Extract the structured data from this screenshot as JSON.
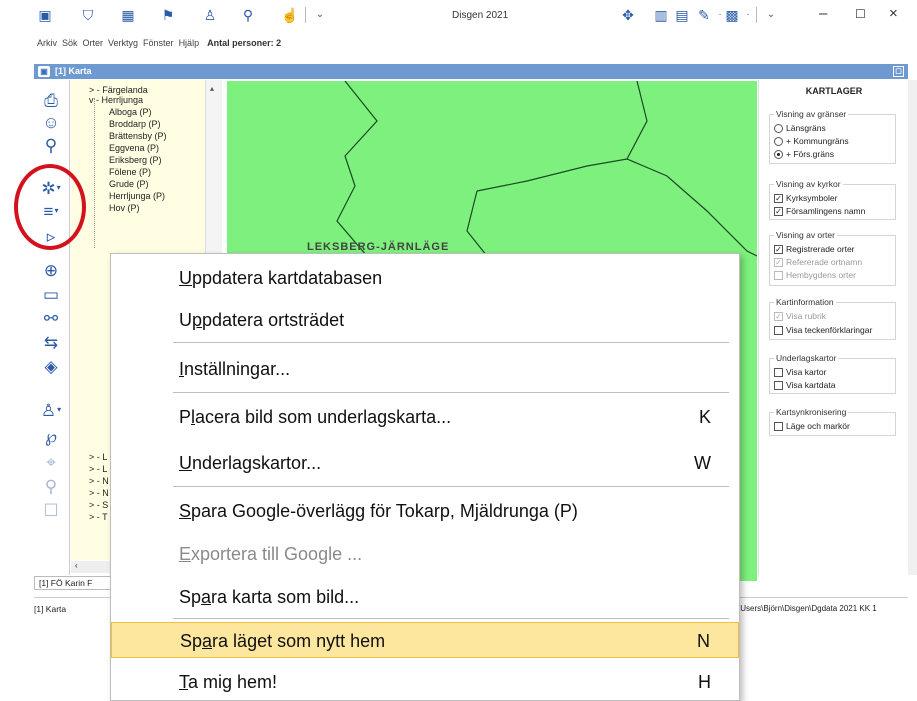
{
  "app": {
    "title": "Disgen 2021",
    "menu": [
      "Arkiv",
      "Sök",
      "Orter",
      "Verktyg",
      "Fönster",
      "Hjälp"
    ],
    "persons_label": "Antal personer: 2"
  },
  "window": {
    "title": "[1] Karta",
    "tab_label": "[1] FÖ Karin F",
    "status_left": "[1] Karta",
    "status_right": "\\Users\\Björn\\Disgen\\Dgdata 2021 KK 1"
  },
  "tree": {
    "items": [
      {
        "label": "Färgelanda",
        "prefix": ">"
      },
      {
        "label": "Herrljunga",
        "prefix": "v"
      },
      {
        "label": "Alboga (P)"
      },
      {
        "label": "Broddarp (P)"
      },
      {
        "label": "Brättensby (P)"
      },
      {
        "label": "Eggvena (P)"
      },
      {
        "label": "Eriksberg (P)"
      },
      {
        "label": "Fölene (P)"
      },
      {
        "label": "Grude (P)"
      },
      {
        "label": "Herrljunga (P)"
      },
      {
        "label": "Hov (P)"
      }
    ],
    "bottom_items": [
      "L",
      "L",
      "N",
      "N",
      "S",
      "T"
    ]
  },
  "layers": {
    "title": "KARTLAGER",
    "groups": [
      {
        "title": "Visning av gränser",
        "type": "radio",
        "options": [
          {
            "label": "Länsgräns",
            "checked": false,
            "disabled": false
          },
          {
            "label": "+ Kommungräns",
            "checked": false,
            "disabled": false
          },
          {
            "label": "+ Förs.gräns",
            "checked": true,
            "disabled": false
          }
        ]
      },
      {
        "title": "Visning av kyrkor",
        "type": "check",
        "options": [
          {
            "label": "Kyrksymboler",
            "checked": true,
            "disabled": false
          },
          {
            "label": "Församlingens namn",
            "checked": true,
            "disabled": false
          }
        ]
      },
      {
        "title": "Visning av orter",
        "type": "check",
        "options": [
          {
            "label": "Registrerade orter",
            "checked": true,
            "disabled": false
          },
          {
            "label": "Refererade ortnamn",
            "checked": true,
            "disabled": true
          },
          {
            "label": "Hembygdens orter",
            "checked": false,
            "disabled": true
          }
        ]
      },
      {
        "title": "Kartinformation",
        "type": "check",
        "options": [
          {
            "label": "Visa rubrik",
            "checked": true,
            "disabled": true
          },
          {
            "label": "Visa teckenförklaringar",
            "checked": false,
            "disabled": false
          }
        ]
      },
      {
        "title": "Underlagskartor",
        "type": "check",
        "options": [
          {
            "label": "Visa kartor",
            "checked": false,
            "disabled": false
          },
          {
            "label": "Visa kartdata",
            "checked": false,
            "disabled": false
          }
        ]
      },
      {
        "title": "Kartsynkronisering",
        "type": "check",
        "options": [
          {
            "label": "Läge och markör",
            "checked": false,
            "disabled": false
          }
        ]
      }
    ]
  },
  "context_menu": {
    "items": [
      {
        "label": "Uppdatera kartdatabasen",
        "mnemonic": "U",
        "key": "",
        "disabled": false,
        "highlight": false
      },
      {
        "label": "Uppdatera ortsträdet",
        "mnemonic": "p",
        "key": "",
        "disabled": false,
        "highlight": false
      },
      {
        "label": "Inställningar...",
        "mnemonic": "I",
        "key": "",
        "disabled": false,
        "highlight": false
      },
      {
        "label": "Placera bild som underlagskarta...",
        "mnemonic": "l",
        "key": "K",
        "disabled": false,
        "highlight": false
      },
      {
        "label": "Underlagskartor...",
        "mnemonic": "U",
        "key": "W",
        "disabled": false,
        "highlight": false
      },
      {
        "label": "Spara Google-överlägg för Tokarp, Mjäldrunga (P)",
        "mnemonic": "S",
        "key": "",
        "disabled": false,
        "highlight": false
      },
      {
        "label": "Exportera till Google ...",
        "mnemonic": "E",
        "key": "",
        "disabled": true,
        "highlight": false
      },
      {
        "label": "Spara karta som bild...",
        "mnemonic": "a",
        "key": "",
        "disabled": false,
        "highlight": false
      },
      {
        "label": "Spara läget som nytt hem",
        "mnemonic": "a",
        "key": "N",
        "disabled": false,
        "highlight": true
      },
      {
        "label": "Ta mig hem!",
        "mnemonic": "T",
        "key": "H",
        "disabled": false,
        "highlight": false
      }
    ]
  },
  "colors": {
    "map_fill": "#7ef07d",
    "accent": "#2a5aa8",
    "highlight": "#fde69d",
    "annotation": "#d4121d"
  },
  "map": {
    "label": "LEKSBERG-JÄRNLÄGE"
  }
}
